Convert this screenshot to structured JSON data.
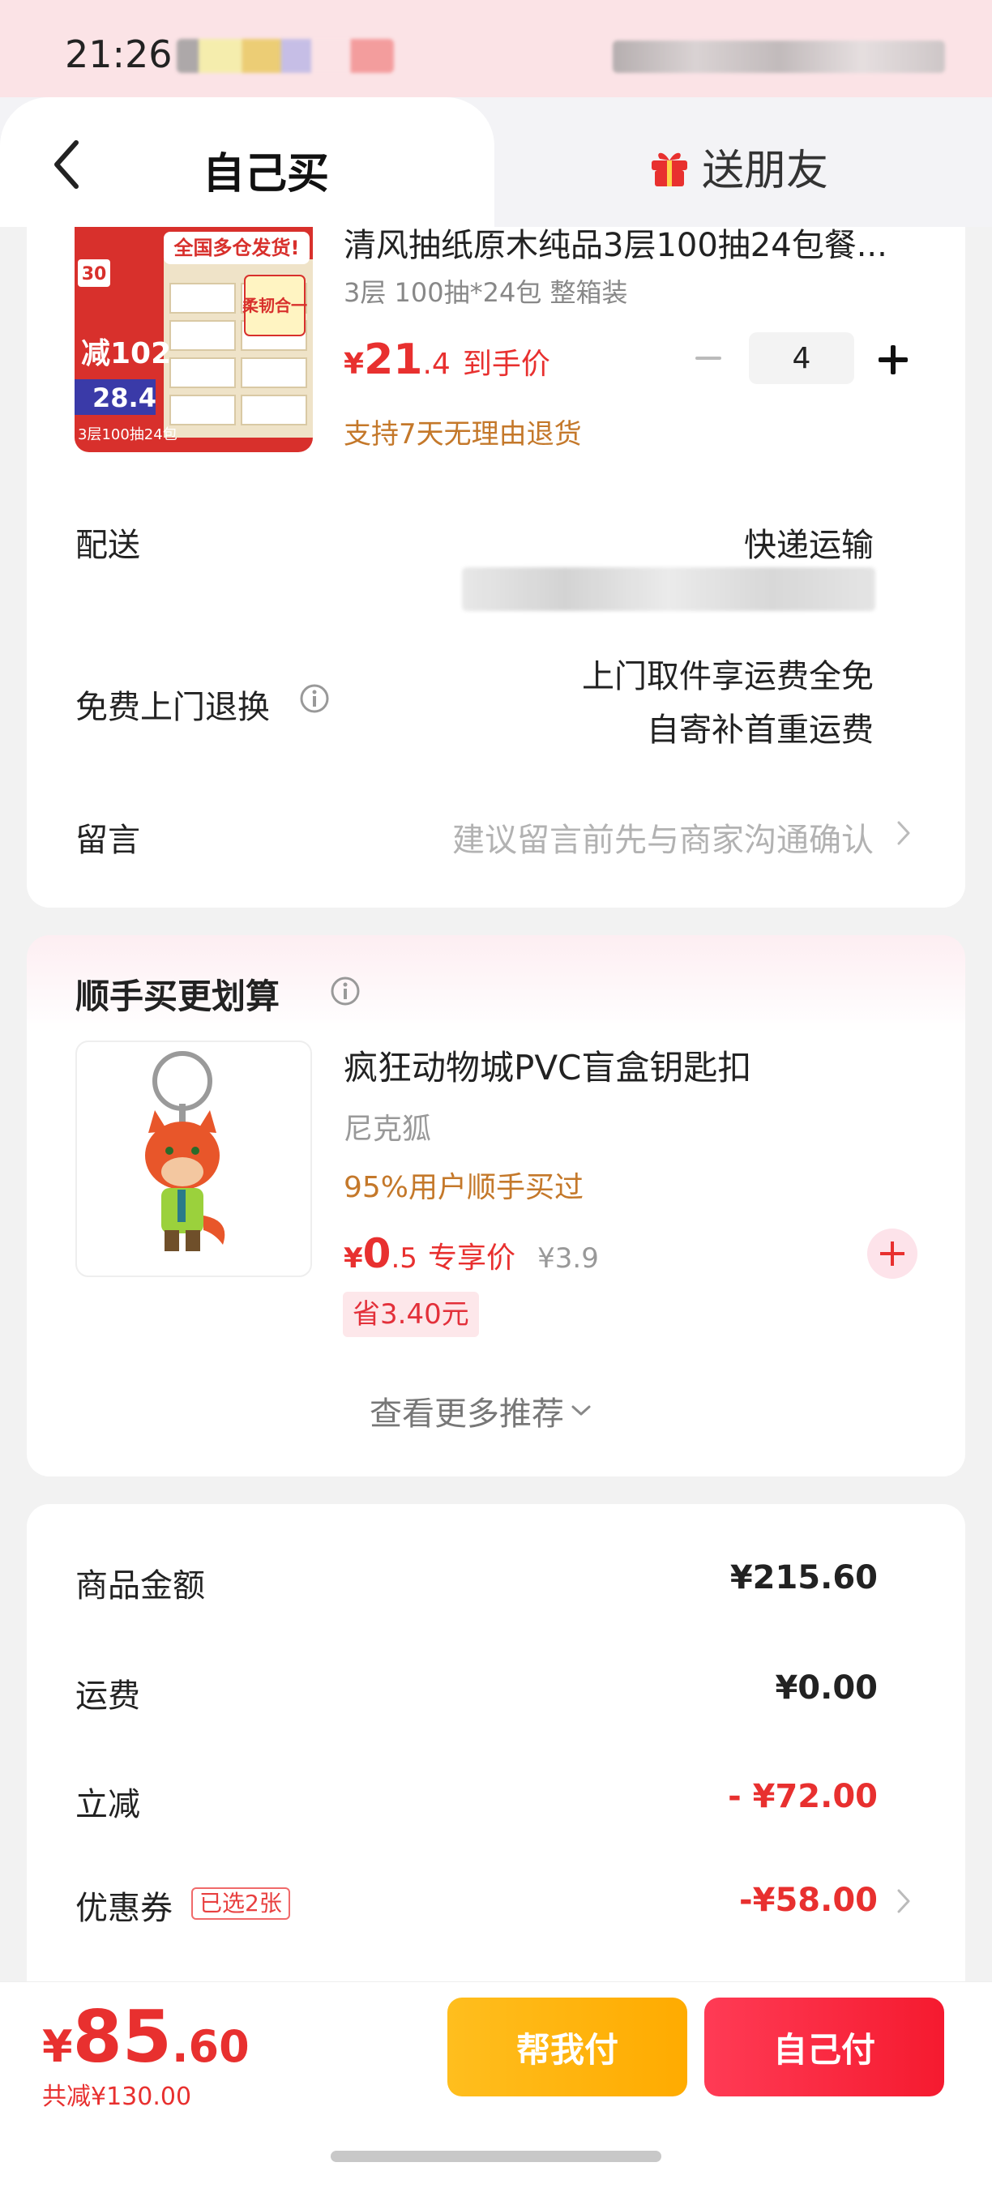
{
  "status_bar": {
    "time": "21:26"
  },
  "header": {
    "tab_self": "自己买",
    "tab_gift": "送朋友"
  },
  "product": {
    "title": "清风抽纸原木纯品3层100抽24包餐...",
    "spec": "3层 100抽*24包 整箱装",
    "price_symbol": "¥",
    "price_int": "21",
    "price_dec": ".4",
    "price_label": "到手价",
    "quantity": "4",
    "return_policy": "支持7天无理由退货",
    "image_texts": {
      "banner": "全国多仓发货!",
      "badge_num": "30",
      "reduce": "减102",
      "price": "28.4",
      "pack": "3层100抽24包",
      "sticker": "柔韧合一"
    }
  },
  "delivery": {
    "label": "配送",
    "value": "快递运输"
  },
  "return_service": {
    "label": "免费上门退换",
    "line1": "上门取件享运费全免",
    "line2": "自寄补首重运费"
  },
  "message": {
    "label": "留言",
    "placeholder": "建议留言前先与商家沟通确认"
  },
  "addon": {
    "section_title": "顺手买更划算",
    "title": "疯狂动物城PVC盲盒钥匙扣",
    "variant": "尼克狐",
    "social_proof": "95%用户顺手买过",
    "price_symbol": "¥",
    "price_int": "0",
    "price_dec": ".5",
    "price_label": "专享价",
    "original_price": "¥3.9",
    "save_text": "省3.40元",
    "more_link": "查看更多推荐"
  },
  "summary": {
    "rows": [
      {
        "label": "商品金额",
        "value": "¥215.60"
      },
      {
        "label": "运费",
        "value": "¥0.00"
      },
      {
        "label": "立减",
        "value": "- ¥72.00"
      },
      {
        "label": "优惠券",
        "value": "-¥58.00",
        "tag": "已选2张"
      }
    ]
  },
  "footer": {
    "total_symbol": "¥",
    "total_int": "85",
    "total_dec": ".60",
    "total_saved": "共减¥130.00",
    "help_pay": "帮我付",
    "self_pay": "自己付"
  },
  "colors": {
    "accent_red": "#e8302f",
    "price_orange": "#c4782a",
    "help_yellow": "#ffb400",
    "pay_red": "#f51a2f"
  },
  "icons": {
    "back": "chevron-left-icon",
    "gift": "gift-icon",
    "info": "info-icon",
    "chevron": "chevron-right-icon",
    "add": "plus-icon"
  }
}
